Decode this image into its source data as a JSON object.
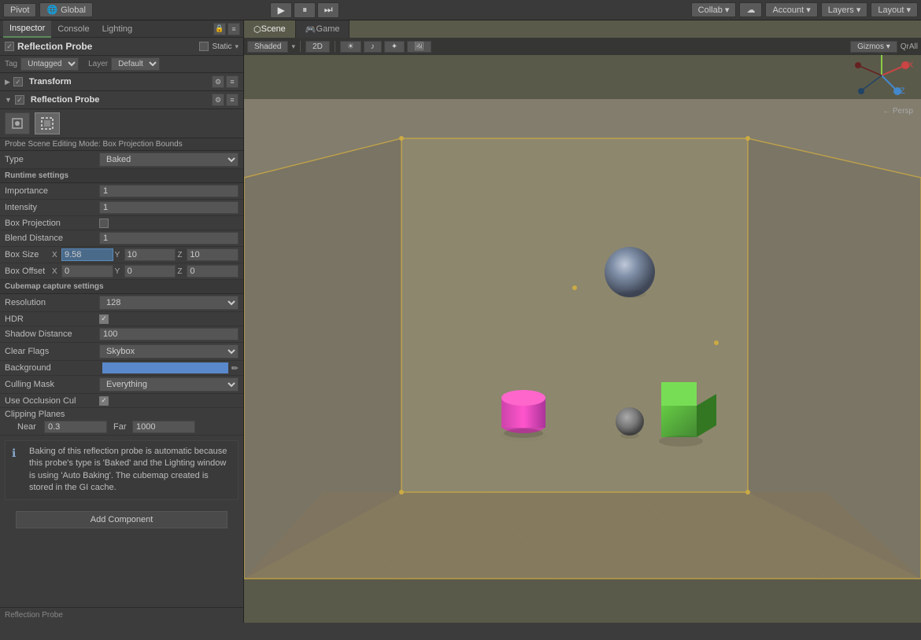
{
  "topbar": {
    "pivot_label": "Pivot",
    "global_label": "Global",
    "play_btn": "▶",
    "pause_btn": "⏸",
    "step_btn": "⏭",
    "collab_label": "Collab ▾",
    "cloud_btn": "☁",
    "account_label": "Account ▾",
    "layers_label": "Layers ▾",
    "layout_label": "Layout ▾"
  },
  "tabs": {
    "inspector": "Inspector",
    "console": "Console",
    "lighting": "Lighting"
  },
  "inspector": {
    "title": "Inspector",
    "obj_name": "Reflection Probe",
    "static_label": "Static",
    "tag_label": "Tag",
    "tag_value": "Untagged",
    "layer_label": "Layer",
    "layer_value": "Default",
    "transform_label": "Transform",
    "reflection_probe_label": "Reflection Probe",
    "probe_mode_label": "Probe Scene Editing Mode: Box Projection Bounds",
    "type_label": "Type",
    "type_value": "Baked",
    "runtime_settings_label": "Runtime settings",
    "importance_label": "Importance",
    "importance_value": "1",
    "intensity_label": "Intensity",
    "intensity_value": "1",
    "box_projection_label": "Box Projection",
    "blend_distance_label": "Blend Distance",
    "blend_distance_value": "1",
    "box_size_label": "Box Size",
    "box_size_x": "9.58",
    "box_size_y": "10",
    "box_size_z": "10",
    "box_offset_label": "Box Offset",
    "box_offset_x": "0",
    "box_offset_y": "0",
    "box_offset_z": "0",
    "cubemap_label": "Cubemap capture settings",
    "resolution_label": "Resolution",
    "resolution_value": "128",
    "hdr_label": "HDR",
    "shadow_distance_label": "Shadow Distance",
    "shadow_distance_value": "100",
    "clear_flags_label": "Clear Flags",
    "clear_flags_value": "Skybox",
    "background_label": "Background",
    "culling_mask_label": "Culling Mask",
    "culling_mask_value": "Everything",
    "use_occlusion_label": "Use Occlusion Cul",
    "clipping_planes_label": "Clipping Planes",
    "near_label": "Near",
    "near_value": "0.3",
    "far_label": "Far",
    "far_value": "1000",
    "info_text": "Baking of this reflection probe is automatic because this probe's type is 'Baked' and the Lighting window is using 'Auto Baking'. The cubemap created is stored in the GI cache.",
    "add_component_label": "Add Component",
    "bottom_label": "Reflection Probe"
  },
  "viewport": {
    "shaded_label": "Shaded",
    "twoD_label": "2D",
    "gizmos_label": "Gizmos ▾",
    "qrall_label": "QrAll",
    "scene_tab": "Scene",
    "game_tab": "Game",
    "persp_label": "← Persp"
  }
}
